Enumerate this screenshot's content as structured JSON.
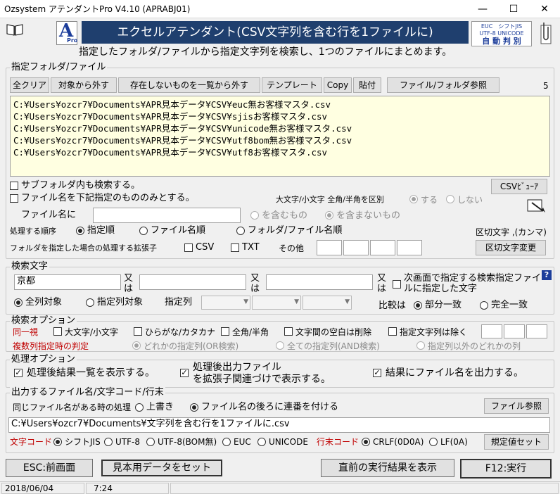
{
  "window": {
    "title": "Ozsystem アテンダントPro V4.10 (APRABJ01)"
  },
  "header": {
    "banner_title": "エクセルアテンダント(CSV文字列を含む行を1ファイルに)",
    "description": "指定したフォルダ/ファイルから指定文字列を検索し、1つのファイルにまとめます。",
    "encoding_badge": {
      "line1": "EUC　シフトJIS",
      "line2": "UTF-8 UNICODE",
      "line3": "自 動 判 別"
    },
    "logo_letter": "A",
    "logo_sub": "Pro"
  },
  "files": {
    "legend": "指定フォルダ/ファイル",
    "buttons": {
      "clear_all": "全クリア",
      "exclude": "対象から外す",
      "exclude_missing": "存在しないものを一覧から外す",
      "template": "テンプレート",
      "copy": "Copy",
      "paste": "貼付",
      "browse": "ファイル/フォルダ参照"
    },
    "count": "5",
    "items": [
      "C:¥Users¥ozcr7¥Documents¥APR見本データ¥CSV¥euc無お客様マスタ.csv",
      "C:¥Users¥ozcr7¥Documents¥APR見本データ¥CSV¥sjisお客様マスタ.csv",
      "C:¥Users¥ozcr7¥Documents¥APR見本データ¥CSV¥unicode無お客様マスタ.csv",
      "C:¥Users¥ozcr7¥Documents¥APR見本データ¥CSV¥utf8bom無お客様マスタ.csv",
      "C:¥Users¥ozcr7¥Documents¥APR見本データ¥CSV¥utf8お客様マスタ.csv"
    ],
    "subfolder_label": "サブフォルダ内も検索する。",
    "filename_filter_label": "ファイル名を下記指定のもののみとする。",
    "csv_viewer": "CSVﾋﾞｭｰｱ",
    "case_label": "大文字/小文字 全角/半角を区別",
    "case_yes": "する",
    "case_no": "しない",
    "filename_label": "ファイル名に",
    "contains": "を含むもの",
    "not_contains": "を含まないもの",
    "order_label": "処理する順序",
    "order_specified": "指定順",
    "order_filename": "ファイル名順",
    "order_folder_filename": "フォルダ/ファイル名順",
    "delimiter_label": "区切文字 ,(カンマ)",
    "ext_label": "フォルダを指定した場合の処理する拡張子",
    "ext_csv": "CSV",
    "ext_txt": "TXT",
    "ext_other": "その他",
    "delimiter_change": "区切文字変更"
  },
  "search": {
    "legend": "検索文字",
    "term1": "京都",
    "or1": "又は",
    "or2": "又は",
    "or3": "又は",
    "next_screen_label": "次画面で指定する検索指定ファイルに指定した文字",
    "help": "?",
    "all_columns": "全列対象",
    "specified_columns": "指定列対象",
    "column_label": "指定列",
    "compare_label": "比較は",
    "partial": "部分一致",
    "exact": "完全一致"
  },
  "options": {
    "legend": "検索オプション",
    "same_label": "同一視",
    "case": "大文字/小文字",
    "kana": "ひらがな/カタカナ",
    "width": "全角/半角",
    "space": "文字間の空白は削除",
    "exclude_chars": "指定文字列は除く",
    "multi_label": "複数列指定時の判定",
    "multi_any": "どれかの指定列(OR検索)",
    "multi_all": "全ての指定列(AND検索)",
    "multi_other": "指定列以外のどれかの列"
  },
  "process": {
    "legend": "処理オプション",
    "show_results": "処理後結果一覧を表示する。",
    "open_output_l1": "処理後出力ファイル",
    "open_output_l2": "を拡張子関連づけで表示する。",
    "output_filename": "結果にファイル名を出力する。"
  },
  "output": {
    "legend": "出力するファイル名/文字コード/行末",
    "same_name_label": "同じファイル名がある時の処理",
    "overwrite": "上書き",
    "append_number": "ファイル名の後ろに連番を付ける",
    "browse": "ファイル参照",
    "path": "C:¥Users¥ozcr7¥Documents¥文字列を含む行を1ファイルに.csv",
    "charset_label": "文字コード",
    "sjis": "シフトJIS",
    "utf8": "UTF-8",
    "utf8bom": "UTF-8(BOM無)",
    "euc": "EUC",
    "unicode": "UNICODE",
    "eol_label": "行末コード",
    "crlf": "CRLF(0D0A)",
    "lf": "LF(0A)",
    "defaults": "規定値セット"
  },
  "footer": {
    "esc": "ESC:前画面",
    "sample": "見本用データをセット",
    "last_result": "直前の実行結果を表示",
    "run": "F12:実行"
  },
  "statusbar": {
    "date": "2018/06/04",
    "time": "7:24"
  },
  "colors": {
    "banner": "#1f3f6e",
    "listbg": "#ffffe1",
    "accent_red": "#c00000"
  }
}
